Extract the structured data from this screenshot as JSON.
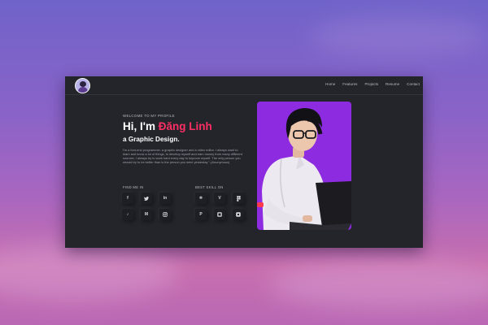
{
  "nav": {
    "items": [
      "Home",
      "Features",
      "Projects",
      "Resume",
      "Contact"
    ]
  },
  "hero": {
    "welcome": "WELCOME TO MY PROFILE",
    "greeting": "Hi, I'm ",
    "name": "Đăng Linh",
    "role": "a Graphic Design.",
    "bio": "I'm a font-end programmer, a graphic designer and a video editor. I always want to learn and know a lot of things, to develop myself and earn money from many different sources. I always try to work hard every day to improve myself. The only person you should try to be better than is the person you were yesterday \"-(Anonymous)"
  },
  "social": {
    "label": "FIND ME IN",
    "icons": [
      "facebook-icon",
      "twitter-icon",
      "linkedin-icon",
      "tiktok-icon",
      "medium-icon",
      "instagram-icon"
    ]
  },
  "skills": {
    "label": "BEST SKILL ON",
    "icons": [
      "react-icon",
      "vue-icon",
      "figma-icon",
      "photoshop-icon",
      "premiere-icon",
      "after-effects-icon"
    ]
  },
  "colors": {
    "accent": "#ff2e63",
    "panel": "#23252b",
    "photo_bg": "#8d2be0"
  }
}
